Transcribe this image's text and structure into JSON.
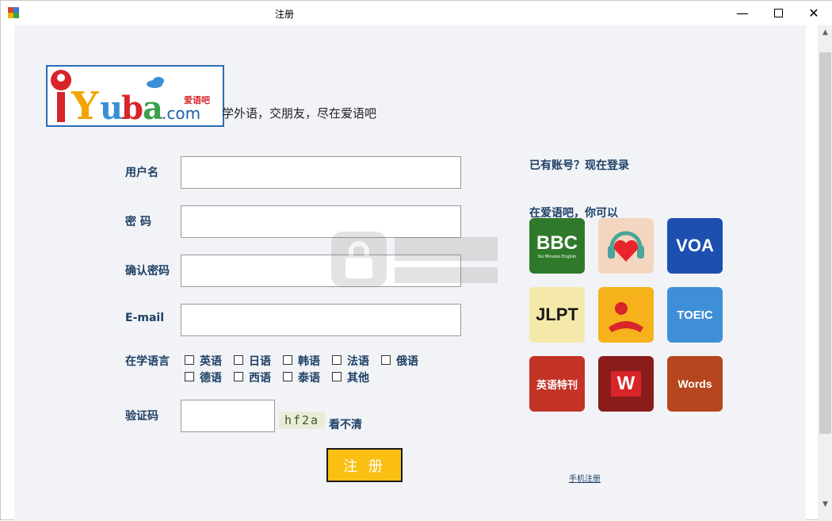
{
  "window": {
    "title": "注册",
    "controls": [
      "minimize",
      "maximize",
      "close"
    ]
  },
  "logo": {
    "text": "iYuba.com",
    "subtitle": "爱语吧"
  },
  "tagline": "学外语，交朋友，尽在爱语吧",
  "form": {
    "username_label": "用户名",
    "password_label": "密 码",
    "confirm_label": "确认密码",
    "email_label": "E-mail",
    "username_value": "",
    "password_value": "",
    "confirm_value": "",
    "email_value": "",
    "languages_label": "在学语言",
    "languages": [
      "英语",
      "日语",
      "韩语",
      "法语",
      "俄语",
      "德语",
      "西语",
      "泰语",
      "其他"
    ],
    "captcha_label": "验证码",
    "captcha_value": "",
    "captcha_text": "hf2a",
    "refresh_label": "看不清",
    "submit_label": "注 册"
  },
  "sidebar": {
    "login_link": "已有账号？现在登录",
    "apps_heading": "在爱语吧，你可以",
    "apps": [
      {
        "name": "bbc-app-icon",
        "text": "BBC",
        "sub": "Six Minutes English",
        "color": "#2f7a2a"
      },
      {
        "name": "heart-headphones-app-icon",
        "text": "",
        "sub": "",
        "color": "#f4d6c0"
      },
      {
        "name": "voa-app-icon",
        "text": "VOA",
        "sub": "",
        "color": "#1d4fb0"
      },
      {
        "name": "jlpt-app-icon",
        "text": "JLPT",
        "sub": "",
        "color": "#f4e9a8"
      },
      {
        "name": "abc-reader-app-icon",
        "text": "",
        "sub": "",
        "color": "#f6b21b"
      },
      {
        "name": "toeic-app-icon",
        "text": "TOEIC",
        "sub": "",
        "color": "#3f8fd8"
      },
      {
        "name": "voa-special-app-icon",
        "text": "英语特刊",
        "sub": "",
        "color": "#c33326"
      },
      {
        "name": "words-flag-app-icon",
        "text": "W",
        "sub": "",
        "color": "#8a1c1c"
      },
      {
        "name": "words-book-app-icon",
        "text": "Words",
        "sub": "",
        "color": "#b5461d"
      }
    ],
    "mobile_link": "手机注册"
  }
}
